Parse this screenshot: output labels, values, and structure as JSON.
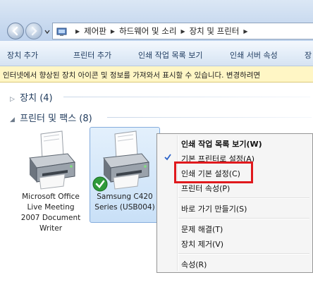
{
  "address": {
    "crumbs": [
      "제어판",
      "하드웨어 및 소리",
      "장치 및 프린터"
    ]
  },
  "commandbar": [
    "장치 추가",
    "프린터 추가",
    "인쇄 작업 목록 보기",
    "인쇄 서버 속성",
    "장"
  ],
  "infobar": "인터넷에서 향상된 장치 아이콘 및 정보를 가져와서 표시할 수 있습니다. 변경하려면",
  "groups": {
    "devices": "장치 (4)",
    "printers": "프린터 및 팩스 (8)"
  },
  "devices": [
    {
      "label_lines": [
        "Microsoft Office",
        "Live Meeting",
        "2007 Document",
        "Writer"
      ]
    },
    {
      "label_lines": [
        "Samsung C420",
        "Series (USB004)"
      ],
      "default": true
    }
  ],
  "context_menu": {
    "items": [
      "인쇄 작업 목록 보기(W)",
      "기본 프린터로 설정(A)",
      "인쇄 기본 설정(C)",
      "프린터 속성(P)",
      "바로 가기 만들기(S)",
      "문제 해결(T)",
      "장치 제거(V)",
      "속성(R)"
    ],
    "checked_item": 1,
    "highlighted_item": 2,
    "highlight_color": "#e0191d"
  }
}
